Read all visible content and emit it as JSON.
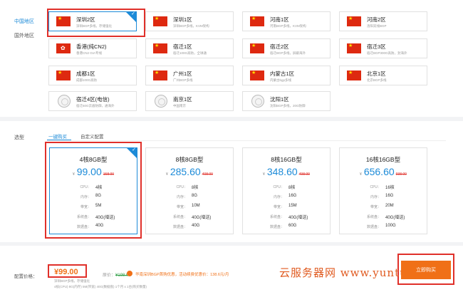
{
  "side_tabs": {
    "region_cn": "中国地区",
    "region_intl": "国外地区",
    "plan_type": "选型",
    "price_label": "配置价格："
  },
  "regions": [
    {
      "name": "深圳2区",
      "desc": "深圳BGP多线，存储强化",
      "icon": "cn-flag-icon",
      "selected": true
    },
    {
      "name": "深圳1区",
      "desc": "深圳BGP多线，KVM架构",
      "icon": "cn-flag-icon",
      "selected": false
    },
    {
      "name": "河南1区",
      "desc": "河南BGP多线，KVM架构",
      "icon": "cn-flag-icon",
      "selected": false
    },
    {
      "name": "河南2区",
      "desc": "洛阳双线BGP",
      "icon": "cn-flag-icon",
      "selected": false
    },
    {
      "name": "香港(纯CN2)",
      "desc": "香港CN2 GIA专线",
      "icon": "hk-flag-icon",
      "selected": false
    },
    {
      "name": "宿迁1区",
      "desc": "宿迁100G高防，全球通",
      "icon": "cn-flag-icon",
      "selected": false
    },
    {
      "name": "宿迁2区",
      "desc": "宿迁BGP多线，屏蔽海外",
      "icon": "cn-flag-icon",
      "selected": false
    },
    {
      "name": "宿迁3区",
      "desc": "宿迁BGP300G高防，封海外",
      "icon": "cn-flag-icon",
      "selected": false
    },
    {
      "name": "成都1区",
      "desc": "成都100G高防",
      "icon": "cn-flag-icon",
      "selected": false
    },
    {
      "name": "广州1区",
      "desc": "广州BGP多线",
      "icon": "cn-flag-icon",
      "selected": false
    },
    {
      "name": "内蒙古1区",
      "desc": "内蒙古bgp多线",
      "icon": "cn-flag-icon",
      "selected": false
    },
    {
      "name": "北京1区",
      "desc": "北京BGP多线",
      "icon": "cn-flag-icon",
      "selected": false
    },
    {
      "name": "宿迁4区(电信)",
      "desc": "宿迁50G云盾防御，通海外",
      "icon": "globe-icon",
      "selected": false
    },
    {
      "name": "南京1区",
      "desc": "中国南京",
      "icon": "globe-icon",
      "selected": false
    },
    {
      "name": "沈阳1区",
      "desc": "沈阳BGP多线，20G防御",
      "icon": "globe-icon",
      "selected": false
    }
  ],
  "plan_tabs": [
    "一键购买",
    "自定义配置"
  ],
  "spec_labels": [
    "CPU：",
    "内存：",
    "带宽：",
    "系统盘：",
    "数据盘："
  ],
  "plans": [
    {
      "title": "4核8GB型",
      "price": "99.00",
      "old": "158.00",
      "specs": [
        "4核",
        "8G",
        "5M",
        "40G(增送)",
        "40G"
      ],
      "selected": true
    },
    {
      "title": "8核8GB型",
      "price": "285.60",
      "old": "408.00",
      "specs": [
        "8核",
        "8G",
        "10M",
        "40G(增送)",
        "40G"
      ],
      "selected": false
    },
    {
      "title": "8核16GB型",
      "price": "348.60",
      "old": "498.00",
      "specs": [
        "8核",
        "16G",
        "15M",
        "40G(增送)",
        "60G"
      ],
      "selected": false
    },
    {
      "title": "16核16GB型",
      "price": "656.60",
      "old": "938.00",
      "specs": [
        "16核",
        "16G",
        "20M",
        "40G(增送)",
        "100G"
      ],
      "selected": false
    }
  ],
  "currency": "¥",
  "footer": {
    "price": "¥99.00",
    "old_prefix": "原价：",
    "old_price": "¥198.00",
    "promo": "华南深圳BGP首购优惠，活动续费优惠价：138.6元/月",
    "sub1": "深圳BGP多线，存储强化",
    "sub2": "4核(CPU) 8G(内存) 5M(带宽) 40G(数据盘) 1个月 x 1台(购买数量)",
    "buy_label": "立即购买"
  },
  "watermark": "云服务器网 www.yuntue",
  "colors": {
    "accent": "#1d8bd8",
    "price": "#f07017",
    "highlight_box": "#e0302a"
  }
}
